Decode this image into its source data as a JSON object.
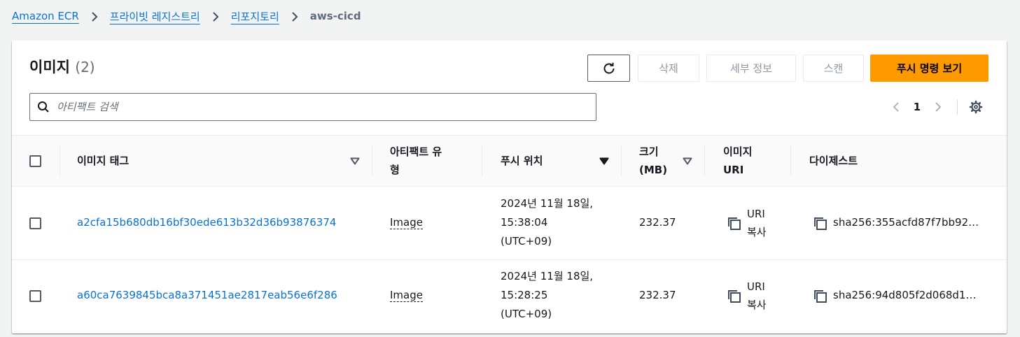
{
  "breadcrumb": {
    "items": [
      "Amazon ECR",
      "프라이빗 레지스트리",
      "리포지토리"
    ],
    "current": "aws-cicd"
  },
  "panel": {
    "title": "이미지",
    "count": "(2)"
  },
  "actions": {
    "delete": "삭제",
    "details": "세부 정보",
    "scan": "스캔",
    "push_commands": "푸시 명령 보기"
  },
  "search": {
    "placeholder": "아티팩트 검색"
  },
  "pagination": {
    "current_page": "1"
  },
  "table": {
    "columns": {
      "tag": "이미지 태그",
      "artifact_type_line1": "아티팩트 유",
      "artifact_type_line2": "형",
      "pushed_at": "푸시 위치",
      "size_line1": "크기",
      "size_line2": "(MB)",
      "uri_line1": "이미지",
      "uri_line2": "URI",
      "digest": "다이제스트"
    },
    "rows": [
      {
        "tag": "a2cfa15b680db16bf30ede613b32d36b93876374",
        "artifact_type": "Image",
        "pushed_line1": "2024년 11월 18일,",
        "pushed_line2": "15:38:04",
        "pushed_line3": "(UTC+09)",
        "size": "232.37",
        "uri_line1": "URI",
        "uri_line2": "복사",
        "digest": "sha256:355acfd87f7bb92…"
      },
      {
        "tag": "a60ca7639845bca8a371451ae2817eab56e6f286",
        "artifact_type": "Image",
        "pushed_line1": "2024년 11월 18일,",
        "pushed_line2": "15:28:25",
        "pushed_line3": "(UTC+09)",
        "size": "232.37",
        "uri_line1": "URI",
        "uri_line2": "복사",
        "digest": "sha256:94d805f2d068d1…"
      }
    ]
  },
  "colors": {
    "link": "#0972d3",
    "primary": "#ff9900",
    "background": "#f2f3f3"
  }
}
